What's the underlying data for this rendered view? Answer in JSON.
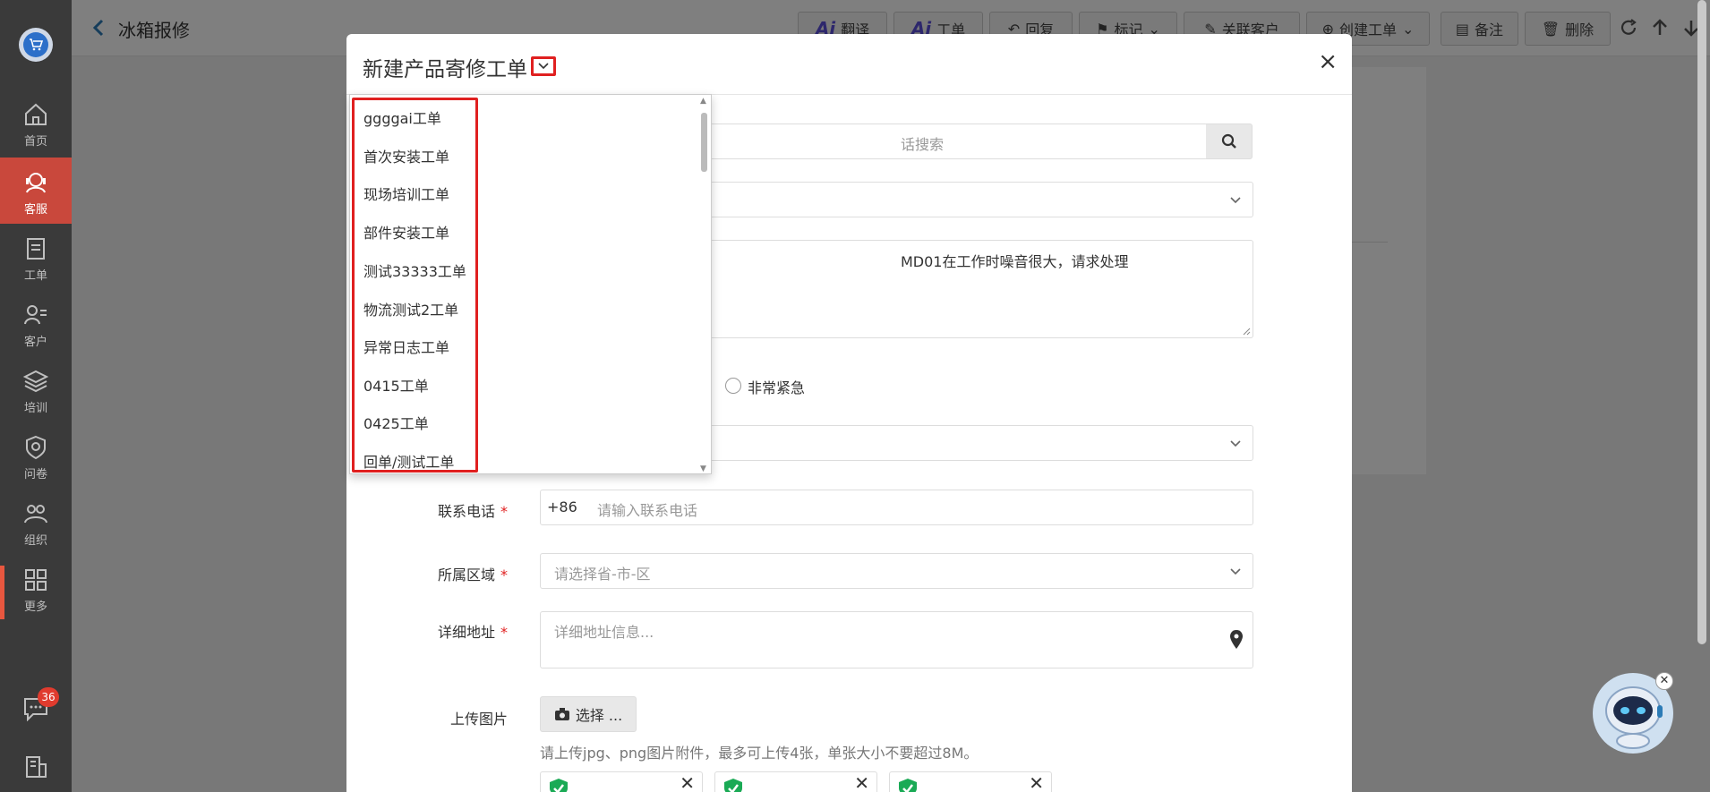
{
  "sidebar": {
    "items": [
      {
        "label": "首页",
        "icon": "home-icon"
      },
      {
        "label": "客服",
        "icon": "headset-icon",
        "active": true
      },
      {
        "label": "工单",
        "icon": "clipboard-icon"
      },
      {
        "label": "客户",
        "icon": "customer-icon"
      },
      {
        "label": "培训",
        "icon": "layers-icon"
      },
      {
        "label": "问卷",
        "icon": "survey-icon"
      },
      {
        "label": "组织",
        "icon": "org-icon"
      },
      {
        "label": "更多",
        "icon": "grid-icon"
      }
    ],
    "chat_badge": "36"
  },
  "header": {
    "title": "冰箱报修",
    "buttons": {
      "translate": "翻译",
      "ai_ticket": "工单",
      "ai_label": "Ai",
      "reply": "回复",
      "tag": "标记",
      "link_customer": "关联客户",
      "create_ticket": "创建工单",
      "note": "备注",
      "delete": "删除"
    }
  },
  "modal": {
    "title": "新建产品寄修工单",
    "search_placeholder": "话搜索",
    "description_text": "MD01在工作时噪音很大，请求处理",
    "priority_option": "非常紧急",
    "phone_label": "联系电话",
    "phone_prefix": "+86",
    "phone_placeholder": "请输入联系电话",
    "region_label": "所属区域",
    "region_placeholder": "请选择省-市-区",
    "address_label": "详细地址",
    "address_placeholder": "详细地址信息...",
    "upload_label": "上传图片",
    "upload_button": "选择 ...",
    "upload_hint": "请上传jpg、png图片附件，最多可上传4张，单张大小不要超过8M。",
    "required_mark": "*",
    "close": "×"
  },
  "dropdown": {
    "items": [
      "ggggai工单",
      "首次安装工单",
      "现场培训工单",
      "部件安装工单",
      "测试33333工单",
      "物流测试2工单",
      "异常日志工单",
      "0415工单",
      "0425工单",
      "回单/测试工单"
    ]
  },
  "colors": {
    "sidebar_bg": "#3a3a3a",
    "active": "#c9483c",
    "highlight": "#e02020",
    "check": "#1aaa55"
  }
}
